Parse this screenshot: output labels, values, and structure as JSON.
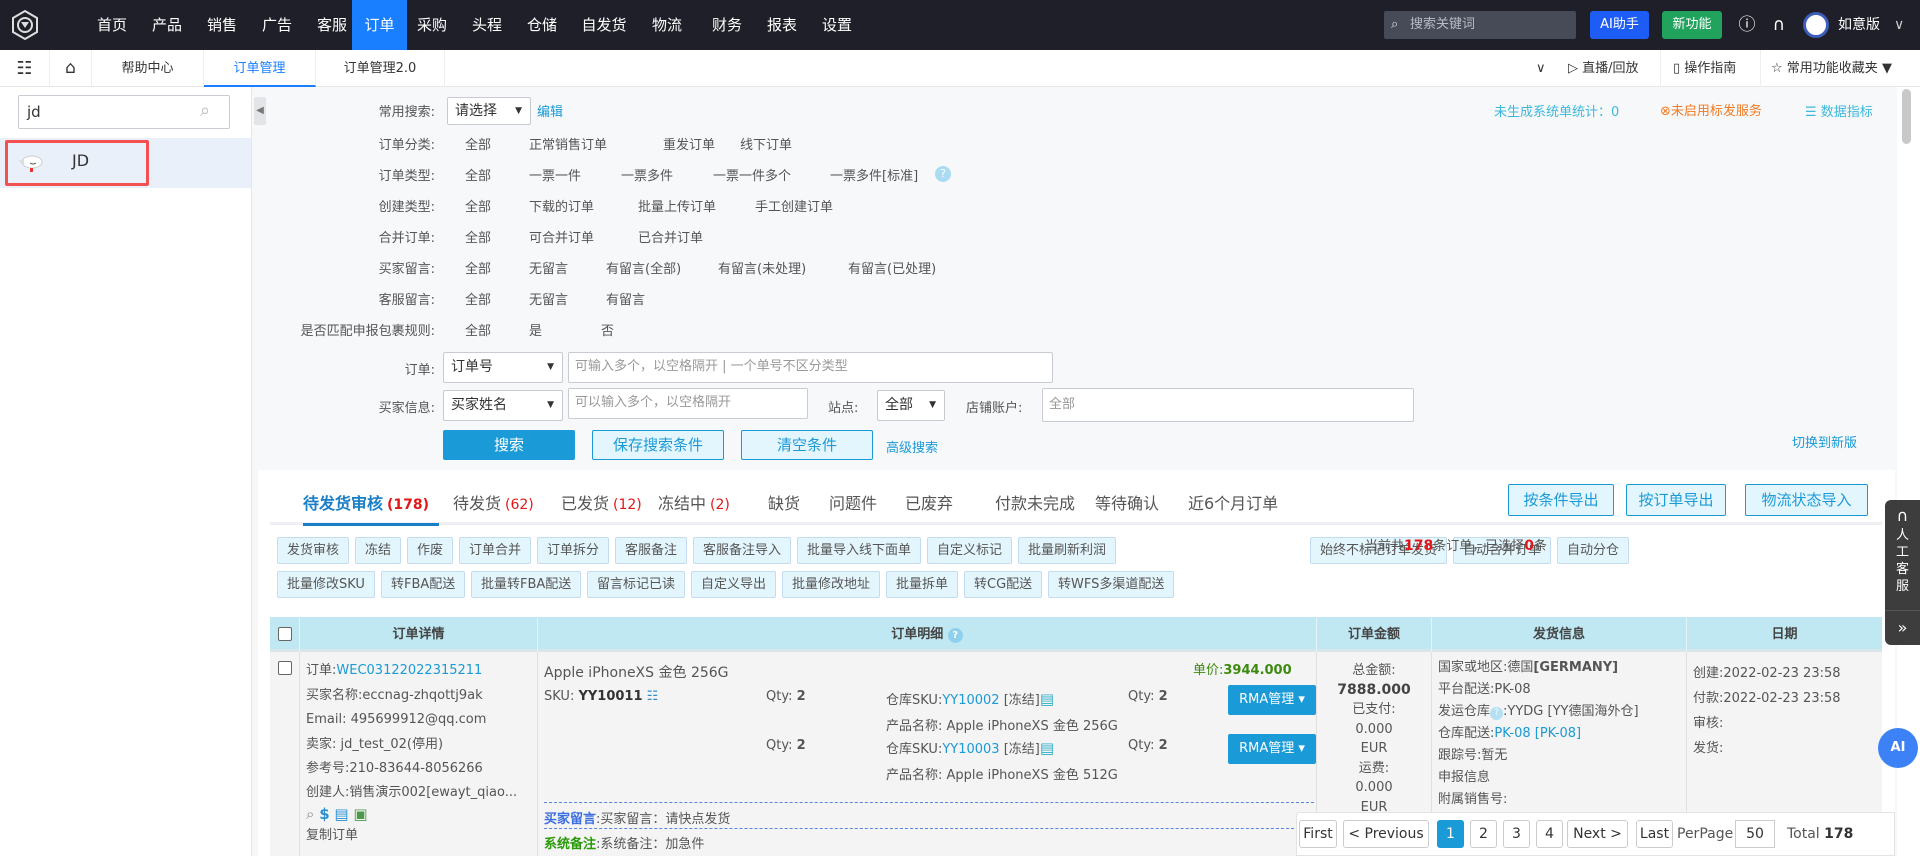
{
  "topbar": {
    "nav": [
      "首页",
      "产品",
      "销售",
      "广告",
      "客服",
      "订单",
      "采购",
      "头程",
      "仓储",
      "自发货",
      "物流",
      "财务",
      "报表",
      "设置"
    ],
    "active_nav": "订单",
    "search_placeholder": "搜索关键词",
    "ai_button": "AI助手",
    "new_feature_button": "新功能",
    "user_name": "如意版",
    "colors": {
      "bg": "#1f1f29",
      "active": "#1a7fff",
      "ai": "#1d5cf5",
      "new": "#21a35e"
    }
  },
  "tabbar": {
    "tabs": [
      "帮助中心",
      "订单管理",
      "订单管理2.0"
    ],
    "active_tab": "订单管理",
    "live": "直播/回放",
    "guide": "操作指南",
    "favorites": "常用功能收藏夹"
  },
  "sidebar": {
    "search_value": "jd",
    "items": [
      {
        "label": "JD"
      }
    ]
  },
  "filters": {
    "common_search": {
      "label": "常用搜索:",
      "value": "请选择",
      "edit": "编辑"
    },
    "rows": [
      {
        "label": "订单分类:",
        "options": [
          "全部",
          "正常销售订单",
          "重发订单",
          "线下订单"
        ]
      },
      {
        "label": "订单类型:",
        "options": [
          "全部",
          "一票一件",
          "一票多件",
          "一票一件多个",
          "一票多件[标准]"
        ]
      },
      {
        "label": "创建类型:",
        "options": [
          "全部",
          "下载的订单",
          "批量上传订单",
          "手工创建订单"
        ]
      },
      {
        "label": "合并订单:",
        "options": [
          "全部",
          "可合并订单",
          "已合并订单"
        ]
      },
      {
        "label": "买家留言:",
        "options": [
          "全部",
          "无留言",
          "有留言(全部)",
          "有留言(未处理)",
          "有留言(已处理)"
        ]
      },
      {
        "label": "客服留言:",
        "options": [
          "全部",
          "无留言",
          "有留言"
        ]
      },
      {
        "label": "是否匹配申报包裹规则:",
        "options": [
          "全部",
          "是",
          "否"
        ]
      }
    ],
    "order": {
      "label": "订单:",
      "type": "订单号",
      "placeholder": "可输入多个，以空格隔开 | 一个单号不区分类型"
    },
    "buyer": {
      "label": "买家信息:",
      "type": "买家姓名",
      "placeholder": "可以输入多个，以空格隔开"
    },
    "site": {
      "label": "站点:",
      "value": "全部"
    },
    "store": {
      "label": "店铺账户:",
      "placeholder": "全部"
    },
    "search_button": "搜索",
    "save_button": "保存搜索条件",
    "clear_button": "清空条件",
    "advanced": "高级搜索",
    "unsynced_stats": "未生成系统单统计：0",
    "label_service": "未启用标发服务",
    "data_metrics": "数据指标",
    "switch_new": "切换到新版"
  },
  "order_tabs": [
    {
      "label": "待发货审核",
      "count": "(178)",
      "active": true
    },
    {
      "label": "待发货",
      "count": "(62)"
    },
    {
      "label": "已发货",
      "count": "(12)"
    },
    {
      "label": "冻结中",
      "count": "(2)"
    },
    {
      "label": "缺货"
    },
    {
      "label": "问题件"
    },
    {
      "label": "已废弃"
    },
    {
      "label": "付款未完成"
    },
    {
      "label": "等待确认"
    },
    {
      "label": "近6个月订单"
    }
  ],
  "export_buttons": [
    "按条件导出",
    "按订单导出",
    "物流状态导入"
  ],
  "actions_row1": [
    "发货审核",
    "冻结",
    "作废",
    "订单合并",
    "订单拆分",
    "客服备注",
    "客服备注导入",
    "批量导入线下面单",
    "自定义标记",
    "批量刷新利润"
  ],
  "actions_row1_right": [
    "始终不标记订单发货",
    "自动合并订单",
    "自动分仓"
  ],
  "actions_row2": [
    "批量修改SKU",
    "转FBA配送",
    "批量转FBA配送",
    "留言标记已读",
    "自定义导出",
    "批量修改地址",
    "批量拆单",
    "转CG配送",
    "转WFS多渠道配送"
  ],
  "count_text": {
    "prefix": "当前共",
    "total": "178",
    "mid": "条订单，已选择",
    "selected": "0",
    "suffix": "条"
  },
  "table": {
    "headers": [
      "订单详情",
      "订单明细",
      "订单金额",
      "发货信息",
      "日期"
    ],
    "row": {
      "order_label": "订单:",
      "order_no": "WEC03122022315211",
      "buyer": "买家名称:eccnag-zhqottj9ak",
      "email": "Email: 495699912@qq.com",
      "seller": "卖家: jd_test_02(停用)",
      "ref": "参考号:210-83644-8056266",
      "creator": "创建人:销售演示002[ewayt_qiao...",
      "copy": "复制订单",
      "product_title": "Apple iPhoneXS 金色 256G",
      "sku_label": "SKU: ",
      "sku": "YY10011",
      "unit_price_label": "单价:",
      "unit_price": "3944.000",
      "items": [
        {
          "qty_label": "Qty: ",
          "qty": "2",
          "wh_label": "仓库SKU:",
          "wh_sku": "YY10002",
          "status": " [冻结]",
          "wqty": "2",
          "name": "产品名称: Apple iPhoneXS 金色 256G",
          "rma": "RMA管理 ▾"
        },
        {
          "qty_label": "Qty: ",
          "qty": "2",
          "wh_label": "仓库SKU:",
          "wh_sku": "YY10003",
          "status": " [冻结]",
          "wqty": "2",
          "name": "产品名称: Apple iPhoneXS 金色 512G",
          "rma": "RMA管理 ▾"
        }
      ],
      "buyer_msg_label": "买家留言",
      "buyer_msg": ":买家留言：请快点发货",
      "sys_note_label": "系统备注",
      "sys_note": ":系统备注：加急件",
      "amount": [
        "总金额:",
        "7888.000",
        "已支付:",
        "0.000",
        "EUR",
        "运费:",
        "0.000",
        "EUR"
      ],
      "ship": {
        "country": "国家或地区:德国",
        "country_code": "[GERMANY]",
        "platform": "平台配送:PK-08",
        "warehouse": ":YYDG [YY德国海外仓]",
        "warehouse_label": "发运仓库",
        "wh_ship_label": "仓库配送:",
        "wh_ship": "PK-08 [PK-08]",
        "tracking": "跟踪号:暂无",
        "declare": "申报信息",
        "extra": "附属销售号:"
      },
      "dates": [
        "创建:2022-02-23 23:58",
        "付款:2022-02-23 23:58",
        "审核:",
        "发货:"
      ]
    }
  },
  "pager": {
    "first": "First",
    "prev": "< Previous",
    "pages": [
      "1",
      "2",
      "3",
      "4"
    ],
    "current": "1",
    "next": "Next >",
    "last": "Last",
    "perpage_label": "PerPage",
    "perpage": "50",
    "total_label": "Total",
    "total": "178"
  },
  "float": {
    "service": "人工客服",
    "expand": "»",
    "ai": "AI"
  }
}
